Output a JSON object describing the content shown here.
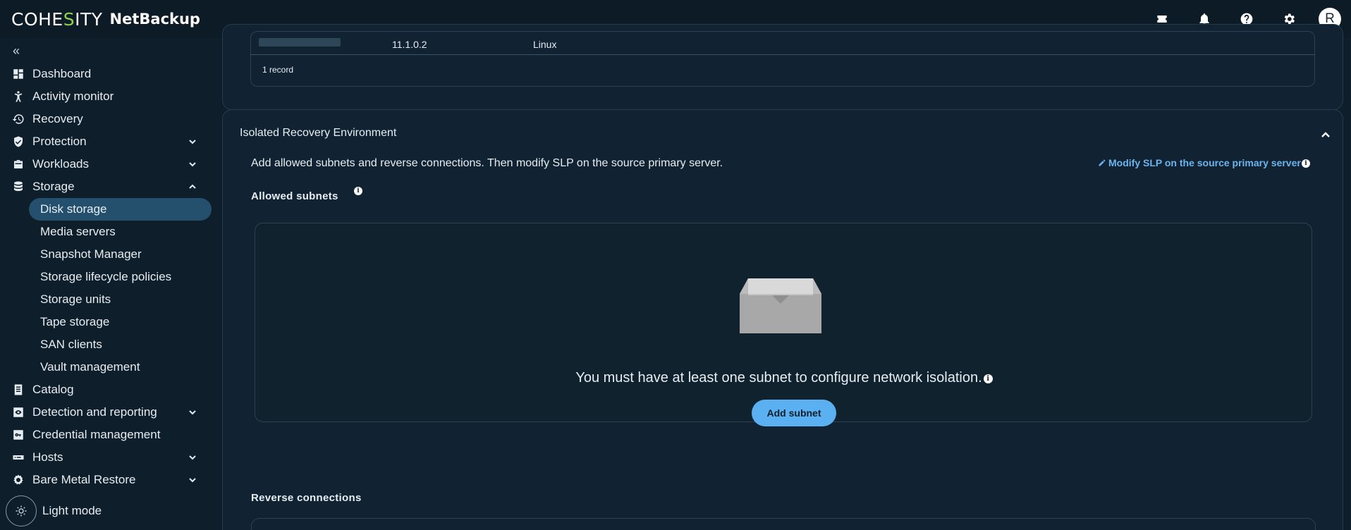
{
  "app": {
    "brand_logo": "COHESITY",
    "brand_product": "NetBackup",
    "avatar_initial": "R"
  },
  "topbar_icons": [
    "ticket-icon",
    "bell-icon",
    "help-icon",
    "gear-icon"
  ],
  "sidebar": {
    "collapse_label": "«",
    "items": [
      {
        "label": "Dashboard",
        "icon": "dashboard-icon"
      },
      {
        "label": "Activity monitor",
        "icon": "activity-icon"
      },
      {
        "label": "Recovery",
        "icon": "history-icon"
      },
      {
        "label": "Protection",
        "icon": "shield-icon",
        "expandable": true
      },
      {
        "label": "Workloads",
        "icon": "briefcase-icon",
        "expandable": true
      },
      {
        "label": "Storage",
        "icon": "database-icon",
        "expanded": true
      }
    ],
    "storage_children": [
      {
        "label": "Disk storage",
        "active": true
      },
      {
        "label": "Media servers"
      },
      {
        "label": "Snapshot Manager"
      },
      {
        "label": "Storage lifecycle policies"
      },
      {
        "label": "Storage units"
      },
      {
        "label": "Tape storage"
      },
      {
        "label": "SAN clients"
      },
      {
        "label": "Vault management"
      }
    ],
    "items_after": [
      {
        "label": "Catalog",
        "icon": "catalog-icon"
      },
      {
        "label": "Detection and reporting",
        "icon": "eye-icon",
        "expandable": true
      },
      {
        "label": "Credential management",
        "icon": "key-icon"
      },
      {
        "label": "Hosts",
        "icon": "server-icon",
        "expandable": true
      },
      {
        "label": "Bare Metal Restore",
        "icon": "gear-wrench-icon",
        "expandable": true
      }
    ],
    "light_mode_label": "Light mode"
  },
  "top_table": {
    "row": {
      "version": "11.1.0.2",
      "os": "Linux"
    },
    "record_count": "1 record"
  },
  "ire": {
    "title": "Isolated Recovery Environment",
    "description": "Add allowed subnets and reverse connections. Then modify SLP on the source primary server.",
    "modify_link": "Modify SLP on the source primary server",
    "allowed_subnets_label": "Allowed subnets",
    "empty_message": "You must have at least one subnet to configure network isolation.",
    "add_subnet_button": "Add subnet",
    "reverse_connections_label": "Reverse connections"
  },
  "colors": {
    "background": "#0f1e2b",
    "accent": "#5ab0f0",
    "link": "#6cb4ee",
    "active_nav": "#24506e",
    "brand_green": "#8fd14f"
  }
}
